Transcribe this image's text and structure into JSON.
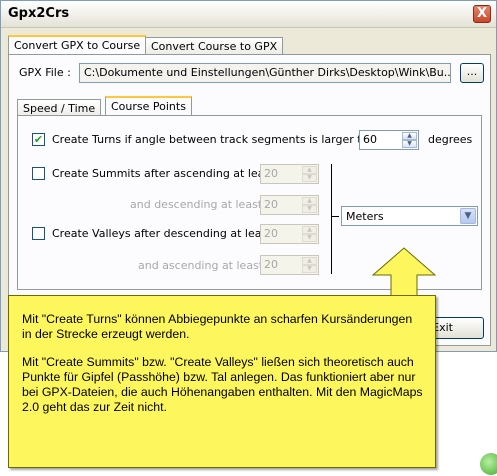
{
  "window": {
    "title": "Gpx2Crs",
    "close": "X"
  },
  "main_tabs": [
    {
      "label": "Convert GPX to Course"
    },
    {
      "label": "Convert Course to GPX"
    }
  ],
  "gpx_file": {
    "label": "GPX File :",
    "value": "C:\\Dokumente und Einstellungen\\Günther Dirks\\Desktop\\Wink\\Bu...",
    "browse": "..."
  },
  "sub_tabs": [
    {
      "label": "Speed / Time"
    },
    {
      "label": "Course Points"
    }
  ],
  "turns": {
    "checked": true,
    "label": "Create Turns if angle between track segments is larger than",
    "value": "60",
    "unit": "degrees"
  },
  "summits": {
    "checked": false,
    "label": "Create Summits after ascending at least",
    "value": "20",
    "desc_label": "and descending at least",
    "desc_value": "20"
  },
  "valleys": {
    "checked": false,
    "label": "Create Valleys after descending at least",
    "value": "20",
    "asc_label": "and ascending at least",
    "asc_value": "20"
  },
  "units_select": {
    "value": "Meters"
  },
  "exit_button": "Exit",
  "note": {
    "p1": "Mit \"Create Turns\" können Abbiegepunkte an scharfen Kursänderungen in der Strecke erzeugt werden.",
    "p2": "Mit \"Create Summits\" bzw. \"Create Valleys\" ließen sich theoretisch auch Punkte für Gipfel (Passhöhe) bzw. Tal anlegen. Das funktioniert aber nur bei GPX-Dateien, die auch Höhenangaben enthalten. Mit den MagicMaps 2.0 geht das zur Zeit nicht."
  },
  "colors": {
    "note_bg": "#fdf65c",
    "window_bg": "#ece9d8",
    "tab_accent": "#ffc83c"
  }
}
